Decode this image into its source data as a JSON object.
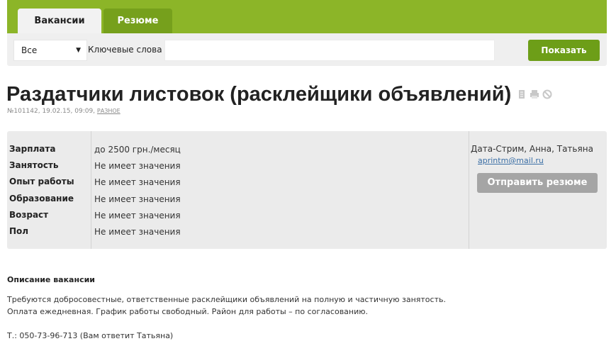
{
  "tabs": [
    {
      "label": "Вакансии",
      "active": true
    },
    {
      "label": "Резюме",
      "active": false
    }
  ],
  "search": {
    "category_selected": "Все",
    "keywords_label": "Ключевые слова",
    "keywords_value": "",
    "submit_label": "Показать"
  },
  "vacancy": {
    "title": "Раздатчики листовок (расклейщики объявлений)",
    "meta": "№101142, 19.02.15, 09:09,",
    "category": "РАЗНОЕ",
    "icons": [
      "document-icon",
      "print-icon",
      "block-icon"
    ]
  },
  "details": [
    {
      "label": "Зарплата",
      "value": "до 2500 грн./месяц"
    },
    {
      "label": "Занятость",
      "value": "Не имеет значения"
    },
    {
      "label": "Опыт работы",
      "value": "Не имеет значения"
    },
    {
      "label": "Образование",
      "value": "Не имеет значения"
    },
    {
      "label": "Возраст",
      "value": "Не имеет значения"
    },
    {
      "label": "Пол",
      "value": "Не имеет значения"
    }
  ],
  "contact": {
    "name": "Дата-Стрим, Анна, Татьяна",
    "email": "aprintm@mail.ru",
    "send_label": "Отправить резюме"
  },
  "description": {
    "title": "Описание вакансии",
    "lines": [
      "Требуются добросовестные, ответственные расклейщики объявлений на полную и частичную занятость.",
      "Оплата ежедневная. График работы свободный. Район для работы – по согласованию.",
      "Т.: 050-73-96-713 (Вам ответит Татьяна)"
    ]
  },
  "colors": {
    "brand_green": "#8cb528",
    "button_green": "#6d9e18",
    "link": "#3a6ea5",
    "send_button": "#a5a5a5"
  }
}
